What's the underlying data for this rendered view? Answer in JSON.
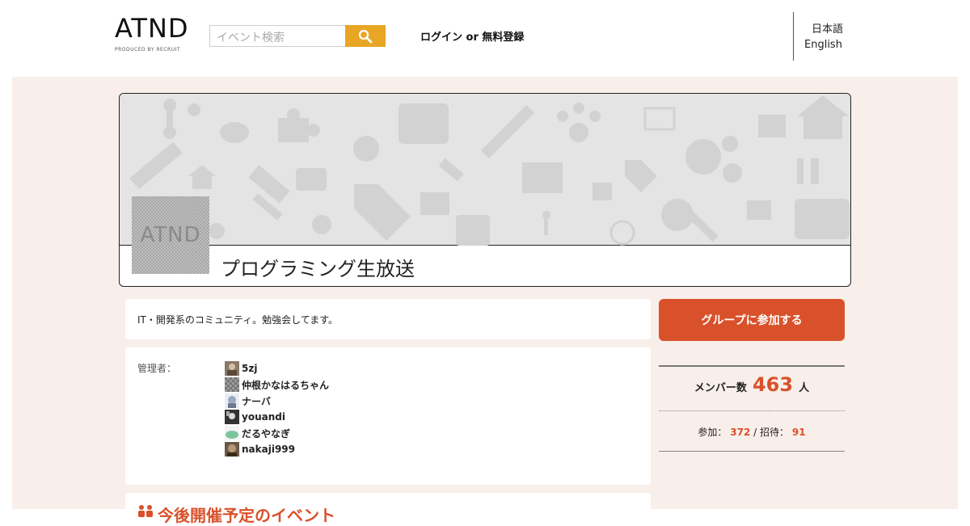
{
  "header": {
    "logo_main": "ATND",
    "logo_sub": "PRODUCED BY RECRUIT",
    "search_placeholder": "イベント検索",
    "search_icon": "search-icon",
    "login_label": "ログイン or 無料登録",
    "lang_ja": "日本語",
    "lang_en": "English"
  },
  "group": {
    "avatar_text": "ATND",
    "title": "プログラミング生放送",
    "description": "IT・開発系のコミュニティ。勉強会してます。"
  },
  "admins": {
    "label": "管理者：",
    "items": [
      {
        "name": "5zj"
      },
      {
        "name": "仲根かなはるちゃん"
      },
      {
        "name": "ナーバ"
      },
      {
        "name": "youandi"
      },
      {
        "name": "だるやなぎ"
      },
      {
        "name": "nakaji999"
      }
    ]
  },
  "upcoming": {
    "title": "今後開催予定のイベント"
  },
  "sidebar": {
    "join_label": "グループに参加する",
    "member_label": "メンバー数",
    "member_count": "463",
    "member_unit": "人",
    "join_count_label": "参加：",
    "join_count": "372",
    "separator": "/",
    "invite_label": "招待：",
    "invite_count": "91"
  },
  "colors": {
    "accent": "#d9512a",
    "search_button": "#e8a625",
    "main_background": "#f9efea"
  }
}
